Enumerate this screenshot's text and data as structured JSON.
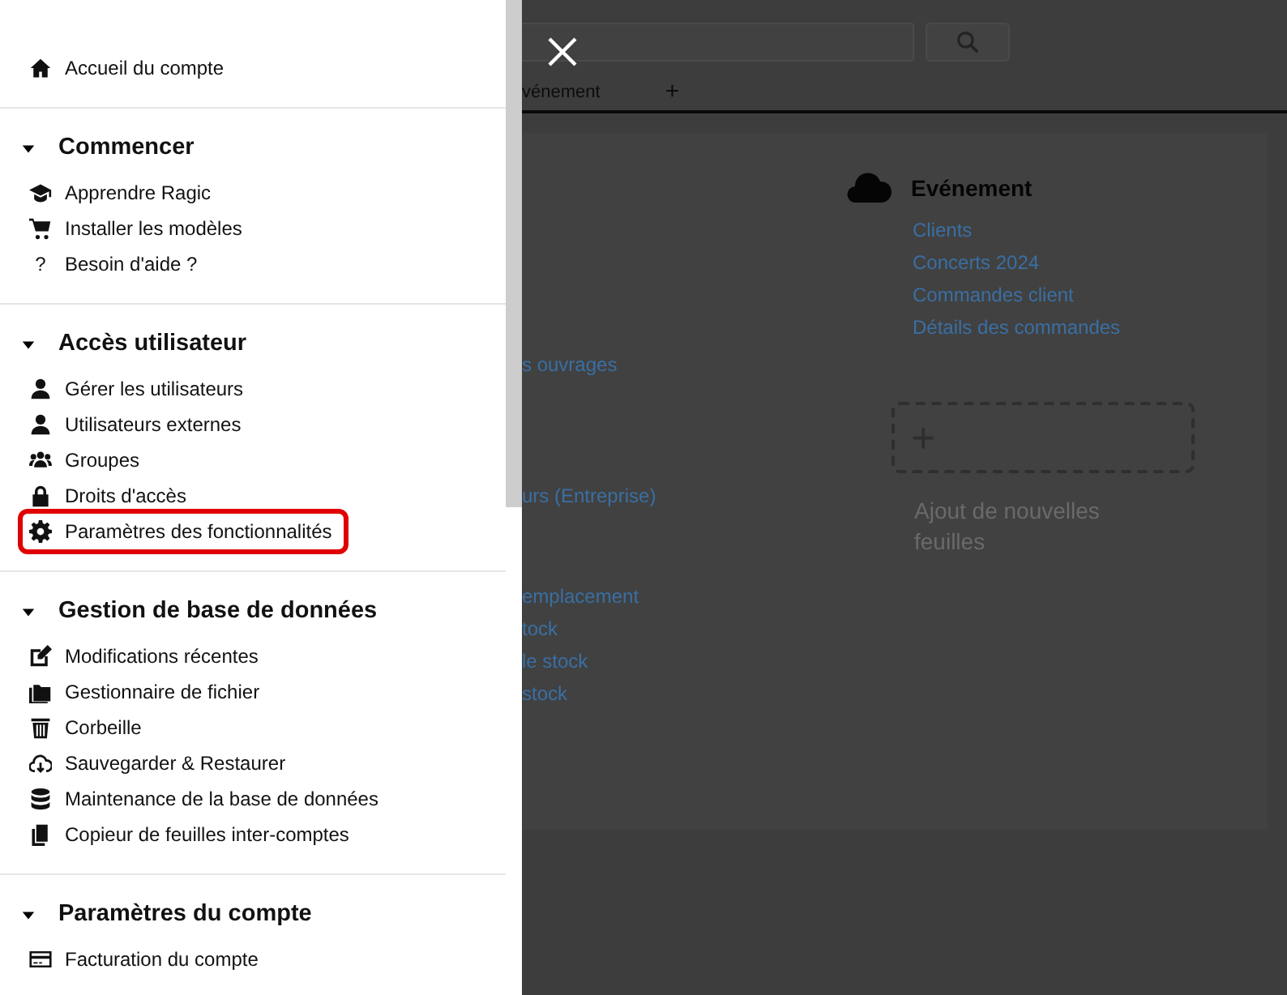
{
  "drawer": {
    "home": {
      "label": "Accueil du compte"
    },
    "sections": [
      {
        "title": "Commencer",
        "expanded": true,
        "items": [
          {
            "label": "Apprendre Ragic",
            "highlighted": false
          },
          {
            "label": "Installer les modèles",
            "highlighted": false
          },
          {
            "label": "Besoin d'aide ?",
            "glyph": "?",
            "highlighted": false
          }
        ]
      },
      {
        "title": "Accès utilisateur",
        "expanded": true,
        "items": [
          {
            "label": "Gérer les utilisateurs",
            "highlighted": false
          },
          {
            "label": "Utilisateurs externes",
            "highlighted": false
          },
          {
            "label": "Groupes",
            "highlighted": false
          },
          {
            "label": "Droits d'accès",
            "highlighted": false
          },
          {
            "label": "Paramètres des fonctionnalités",
            "highlighted": true
          }
        ]
      },
      {
        "title": "Gestion de base de données",
        "expanded": true,
        "items": [
          {
            "label": "Modifications récentes",
            "highlighted": false
          },
          {
            "label": "Gestionnaire de fichier",
            "highlighted": false
          },
          {
            "label": "Corbeille",
            "highlighted": false
          },
          {
            "label": "Sauvegarder & Restaurer",
            "highlighted": false
          },
          {
            "label": "Maintenance de la base de données",
            "highlighted": false
          },
          {
            "label": "Copieur de feuilles inter-comptes",
            "highlighted": false
          }
        ]
      },
      {
        "title": "Paramètres du compte",
        "expanded": true,
        "items": [
          {
            "label": "Facturation du compte",
            "highlighted": false
          }
        ]
      }
    ]
  },
  "background": {
    "tabs": [
      {
        "label": "vénement"
      }
    ],
    "add_tab": "+",
    "left_groups": [
      [
        "s ouvrages"
      ],
      [
        "urs (Entreprise)"
      ],
      [
        "emplacement",
        "tock",
        "le stock",
        "stock"
      ]
    ],
    "module": {
      "title": "Evénement",
      "links": [
        "Clients",
        "Concerts 2024",
        "Commandes client",
        "Détails des commandes"
      ]
    },
    "add_sheet": {
      "plus": "+",
      "label": "Ajout de nouvelles feuilles"
    }
  }
}
